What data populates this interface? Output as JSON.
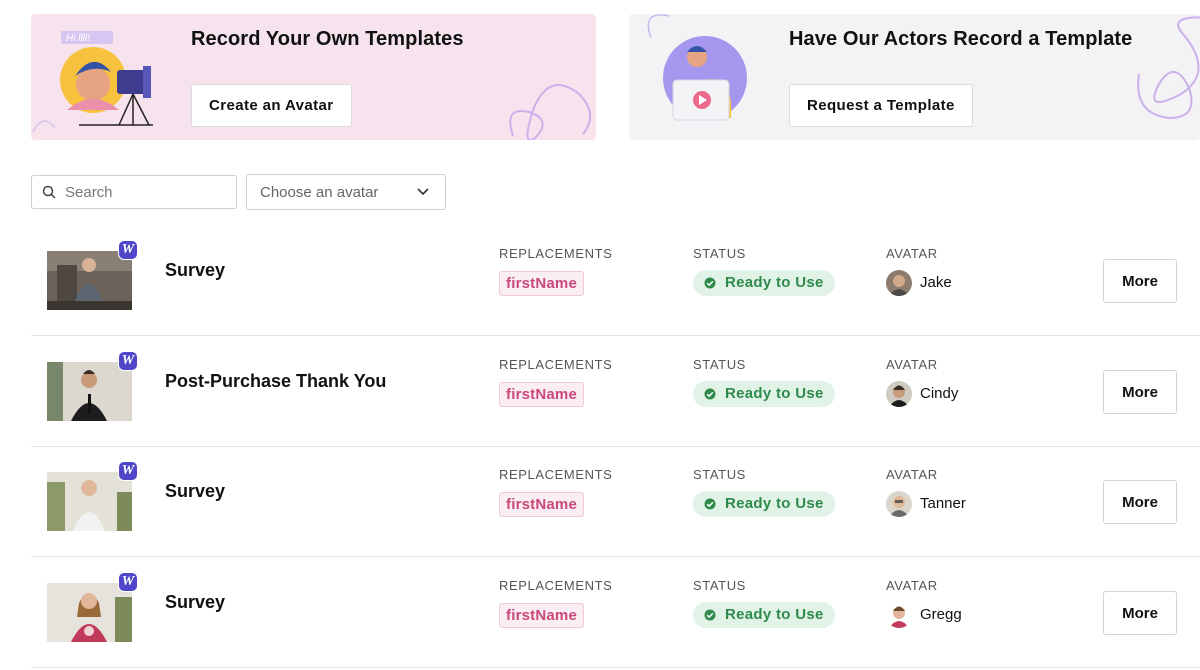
{
  "banners": {
    "own": {
      "title": "Record Your Own Templates",
      "button": "Create an Avatar",
      "art_text": "Hi llll!",
      "bg": "#f6e3ee"
    },
    "actors": {
      "title": "Have Our Actors Record a Template",
      "button": "Request a Template",
      "bg": "#f3f2f5"
    }
  },
  "filters": {
    "search_placeholder": "Search",
    "avatar_select": "Choose an avatar"
  },
  "columns": {
    "replacements": "REPLACEMENTS",
    "status": "STATUS",
    "avatar": "AVATAR"
  },
  "badge_letter": "W",
  "colors": {
    "accent": "#4f46c9",
    "status_green": "#2f8a4c",
    "replacement_pink": "#c9497d"
  },
  "templates": [
    {
      "title": "Survey",
      "replacement": "firstName",
      "status": "Ready to Use",
      "avatar": "Jake",
      "more": "More"
    },
    {
      "title": "Post-Purchase Thank You",
      "replacement": "firstName",
      "status": "Ready to Use",
      "avatar": "Cindy",
      "more": "More"
    },
    {
      "title": "Survey",
      "replacement": "firstName",
      "status": "Ready to Use",
      "avatar": "Tanner",
      "more": "More"
    },
    {
      "title": "Survey",
      "replacement": "firstName",
      "status": "Ready to Use",
      "avatar": "Gregg",
      "more": "More"
    }
  ]
}
